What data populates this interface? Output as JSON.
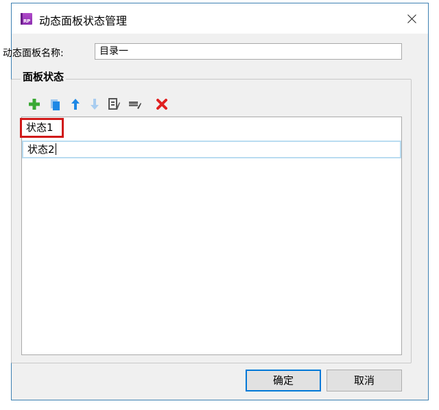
{
  "window": {
    "title": "动态面板状态管理",
    "app_icon_text": "RP",
    "app_icon_color": "#a13fc4",
    "accent_color": "#0078d7"
  },
  "panel_name": {
    "label": "动态面板名称:",
    "value": "目录一"
  },
  "states_group": {
    "title": "面板状态",
    "toolbar": [
      {
        "name": "add-icon",
        "color": "#3aa935"
      },
      {
        "name": "duplicate-icon",
        "color": "#1e88e5"
      },
      {
        "name": "move-up-icon",
        "color": "#1e88e5"
      },
      {
        "name": "move-down-icon",
        "color": "#a9cdf0"
      },
      {
        "name": "edit-state-icon",
        "color": "#555555"
      },
      {
        "name": "edit-all-states-icon",
        "color": "#555555"
      },
      {
        "name": "delete-icon",
        "color": "#e02020"
      }
    ],
    "states": [
      "状态1",
      "状态2"
    ],
    "highlight_color": "#d01818"
  },
  "buttons": {
    "ok": "确定",
    "cancel": "取消"
  }
}
